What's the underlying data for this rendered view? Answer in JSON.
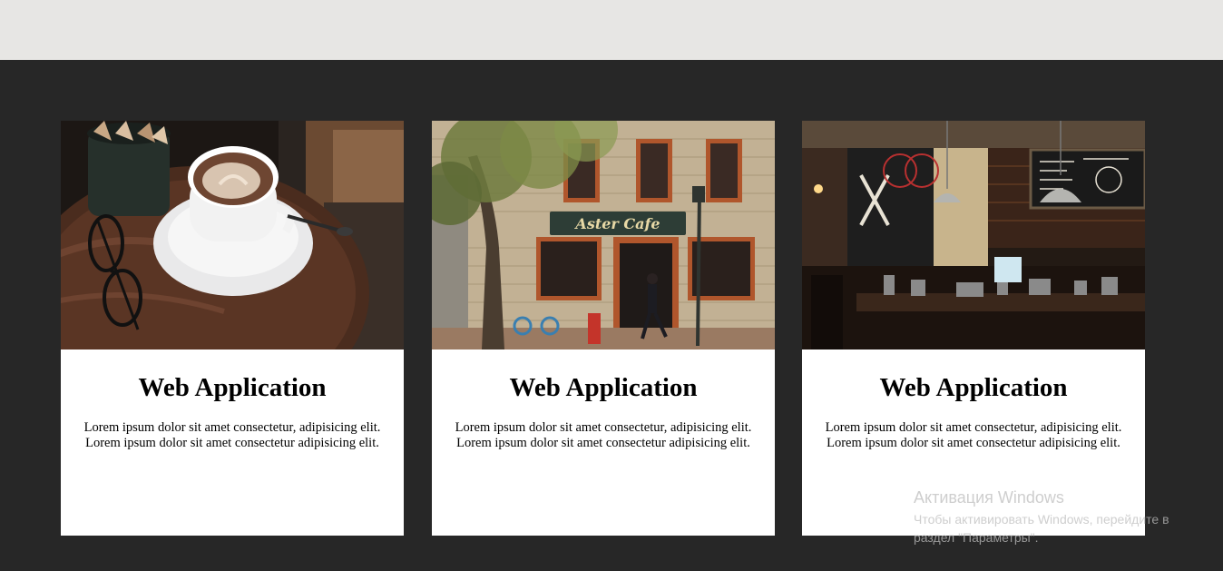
{
  "page": {
    "colors": {
      "top_band": "#e7e6e4",
      "section_bg": "#272727",
      "card_bg": "#ffffff"
    }
  },
  "cards": [
    {
      "image": "coffee-cup-on-table-photo",
      "title": "Web Application",
      "text": "Lorem ipsum dolor sit amet consectetur, adipisicing elit. Lorem ipsum dolor sit amet consectetur adipisicing elit."
    },
    {
      "image": "cafe-storefront-photo",
      "sign": "Aster Cafe",
      "title": "Web Application",
      "text": "Lorem ipsum dolor sit amet consectetur, adipisicing elit. Lorem ipsum dolor sit amet consectetur adipisicing elit."
    },
    {
      "image": "cafe-interior-photo",
      "title": "Web Application",
      "text": "Lorem ipsum dolor sit amet consectetur, adipisicing elit. Lorem ipsum dolor sit amet consectetur adipisicing elit."
    }
  ],
  "watermark": {
    "title": "Активация Windows",
    "text": "Чтобы активировать Windows, перейдите в раздел \"Параметры\"."
  }
}
